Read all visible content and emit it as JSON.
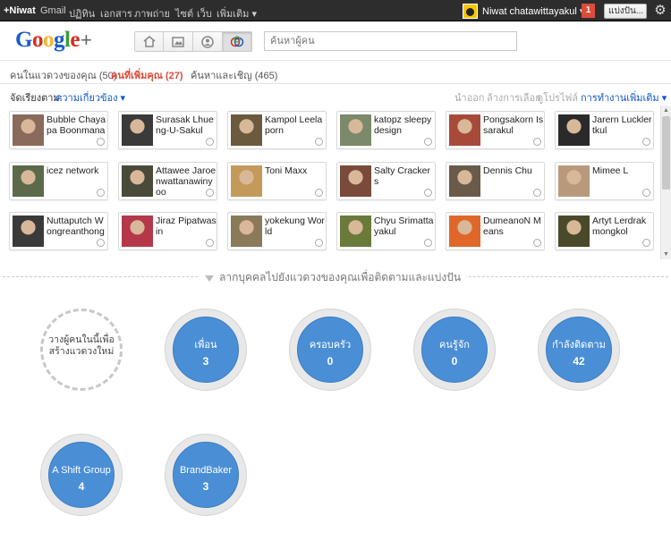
{
  "topbar": {
    "links": [
      {
        "label": "+Niwat",
        "active": true
      },
      {
        "label": "Gmail"
      },
      {
        "label": "ปฏิทิน"
      },
      {
        "label": "เอกสาร"
      },
      {
        "label": "ภาพถ่าย"
      },
      {
        "label": "ไซต์"
      },
      {
        "label": "เว็บ"
      },
      {
        "label": "เพิ่มเติม ▾"
      }
    ],
    "user_name": "Niwat chatawittayakul ▾",
    "notification_count": "1",
    "share_label": "แบ่งปัน...",
    "gear_glyph": "⚙"
  },
  "header": {
    "logo": {
      "g1": "G",
      "o1": "o",
      "o2": "o",
      "g2": "g",
      "l": "l",
      "e": "e",
      "plus": "+"
    },
    "app_buttons": [
      {
        "icon": "home-icon",
        "glyph": "⌂"
      },
      {
        "icon": "photos-icon",
        "glyph": "▣"
      },
      {
        "icon": "profile-icon",
        "glyph": "◉"
      },
      {
        "icon": "circles-icon",
        "glyph": "◎",
        "active": true
      }
    ],
    "search_placeholder": "ค้นหาผู้คน"
  },
  "tabs": [
    {
      "label": "คนในแวดวงของคุณ (50)"
    },
    {
      "label": "คนที่เพิ่มคุณ (27)",
      "active": true
    },
    {
      "label": "ค้นหาและเชิญ (465)"
    }
  ],
  "toolbar": {
    "sort_label": "จัดเรียงตาม:",
    "sort_value": "ความเกี่ยวข้อง ▾",
    "actions": [
      "นำออก",
      "ล้างการเลือก",
      "ดูโปรไฟล์",
      "การทำงานเพิ่มเติม ▾"
    ]
  },
  "people": [
    {
      "name": "Bubble Chayapa Boonmana",
      "photo": "#8a6a5a"
    },
    {
      "name": "Surasak Lhueng-U-Sakul",
      "photo": "#3a3a3a"
    },
    {
      "name": "Kampol Leelaporn",
      "photo": "#6b5a3d"
    },
    {
      "name": "katopz sleepydesign",
      "photo": "#7a8a6a"
    },
    {
      "name": "Pongsakorn Issarakul",
      "photo": "#a84a3a"
    },
    {
      "name": "Jarern Lucklertkul",
      "photo": "#2a2a2a"
    },
    {
      "name": "icez network",
      "photo": "#5a6a4a"
    },
    {
      "name": "Attawee Jaroenwattanawinyoo",
      "photo": "#4a4a3a"
    },
    {
      "name": "Toni Maxx",
      "photo": "#c49a5a"
    },
    {
      "name": "Salty Crackers",
      "photo": "#7a4a3a"
    },
    {
      "name": "Dennis Chu",
      "photo": "#6a5a4a"
    },
    {
      "name": "Mimee L",
      "photo": "#b89a7a"
    },
    {
      "name": "Nuttaputch Wongreanthong",
      "photo": "#3a3a3a"
    },
    {
      "name": "Jiraz Pipatwasin",
      "photo": "#b4384a"
    },
    {
      "name": "yokekung World",
      "photo": "#8a7a5a"
    },
    {
      "name": "Chyu Srimattayakul",
      "photo": "#6a7a3a"
    },
    {
      "name": "DumeanoN Means",
      "photo": "#e0672a"
    },
    {
      "name": "Artyt Lerdrakmongkol",
      "photo": "#4a4a2a"
    }
  ],
  "drag_hint": "ลากบุคคลไปยังแวดวงของคุณเพื่อติดตามและแบ่งปัน",
  "new_circle_label": "วางผู้คนในนี้เพื่อสร้างแวดวงใหม่",
  "circles": [
    {
      "name": "เพื่อน",
      "count": "3"
    },
    {
      "name": "ครอบครัว",
      "count": "0"
    },
    {
      "name": "คนรู้จัก",
      "count": "0"
    },
    {
      "name": "กำลังติดตาม",
      "count": "42"
    },
    {
      "name": "A Shift Group",
      "count": "4"
    },
    {
      "name": "BrandBaker",
      "count": "3"
    }
  ],
  "colors": {
    "accent_red": "#dd4b39",
    "link_blue": "#1155cc",
    "circle_blue": "#4a8fd6",
    "topbar": "#2d2d2d"
  }
}
